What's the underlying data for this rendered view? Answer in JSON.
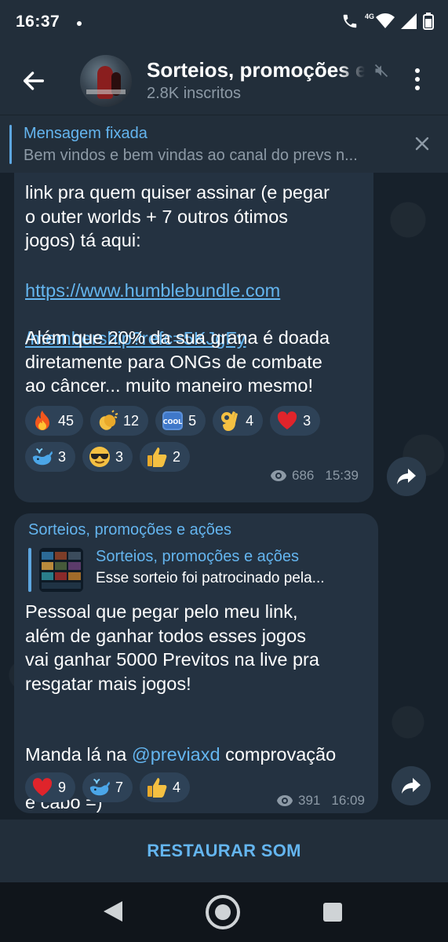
{
  "status_bar": {
    "time": "16:37",
    "network": "4G"
  },
  "header": {
    "title": "Sorteios, promoções e ações",
    "subscribers": "2.8K inscritos"
  },
  "pinned": {
    "label": "Mensagem fixada",
    "text": "Bem vindos e bem vindas ao canal do prevs n..."
  },
  "message1": {
    "text_top": "link pra quem quiser assinar (e pegar\no outer worlds + 7 outros ótimos\njogos) tá aqui:",
    "link_line1": "https://www.humblebundle.com",
    "link_line2": "/membership?refc=5KJgFy",
    "text_bottom": "Além que 20% da sua grana é doada\ndiretamente para ONGs de combate\nao câncer... muito maneiro mesmo!",
    "reactions": [
      {
        "icon": "fire",
        "count": "45"
      },
      {
        "icon": "clapping-hands",
        "count": "12"
      },
      {
        "icon": "cool",
        "count": "5"
      },
      {
        "icon": "ok-hand",
        "count": "4"
      },
      {
        "icon": "red-heart",
        "count": "3"
      },
      {
        "icon": "whale",
        "count": "3"
      },
      {
        "icon": "sunglasses-face",
        "count": "3"
      },
      {
        "icon": "thumbs-up",
        "count": "2"
      }
    ],
    "views": "686",
    "time": "15:39",
    "cool_label": "COOL"
  },
  "message2": {
    "sender": "Sorteios, promoções e ações",
    "forward_title": "Sorteios, promoções e ações",
    "forward_text": "Esse sorteio foi patrocinado pela...",
    "text_main": "Pessoal que pegar pelo meu link,\nalém de ganhar todos esses jogos\nvai ganhar 5000 Previtos na live pra\nresgatar mais jogos!",
    "text_pre_mention": "Manda lá na ",
    "mention": "@previaxd",
    "text_post_mention": " comprovação",
    "text_last": "e cabo =)",
    "reactions": [
      {
        "icon": "red-heart",
        "count": "9"
      },
      {
        "icon": "whale",
        "count": "7"
      },
      {
        "icon": "thumbs-up",
        "count": "4"
      }
    ],
    "views": "391",
    "time": "16:09"
  },
  "bottom_action": "RESTAURAR SOM",
  "colors": {
    "accent": "#64b5ef",
    "bubble": "#243241",
    "background": "#17212b"
  }
}
